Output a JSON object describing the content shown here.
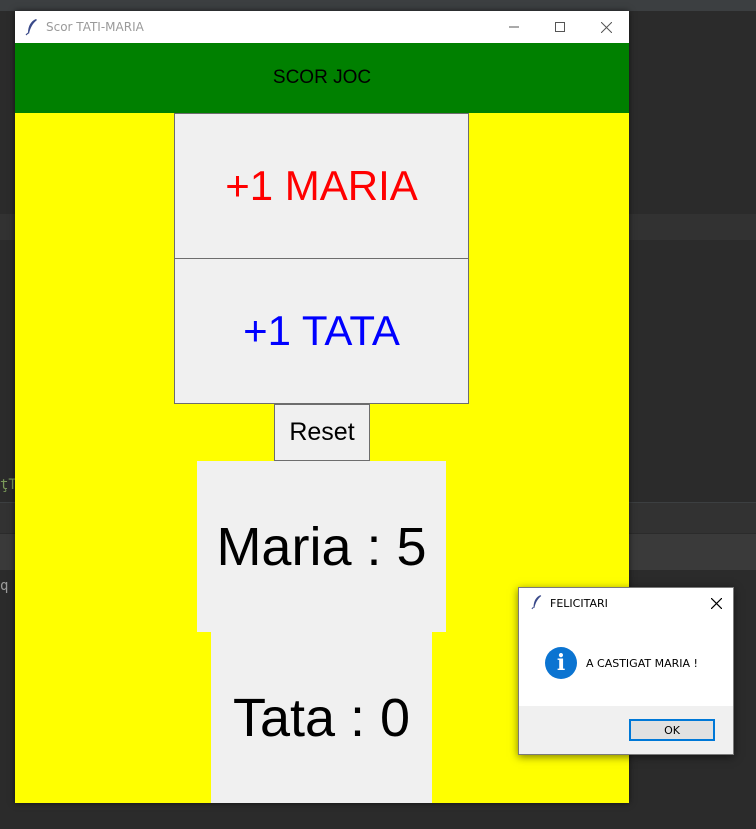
{
  "main_window": {
    "title": "Scor TATI-MARIA",
    "header": "SCOR JOC",
    "buttons": {
      "add_maria": "+1 MARIA",
      "add_tata": "+1 TATA",
      "reset": "Reset"
    },
    "scores": {
      "maria": "Maria : 5",
      "tata": "Tata : 0"
    }
  },
  "dialog": {
    "title": "FELICITARI",
    "message": "A CASTIGAT MARIA !",
    "ok_label": "OK"
  },
  "background_fragments": {
    "frag1": "ţT",
    "frag2": "q"
  },
  "colors": {
    "header_bg": "#008000",
    "window_bg": "#ffff00",
    "maria_text": "#ff0000",
    "tata_text": "#0000ff",
    "info_icon": "#0b74d1"
  },
  "icons": [
    "feather-icon",
    "minimize-icon",
    "maximize-icon",
    "close-icon",
    "info-icon"
  ]
}
